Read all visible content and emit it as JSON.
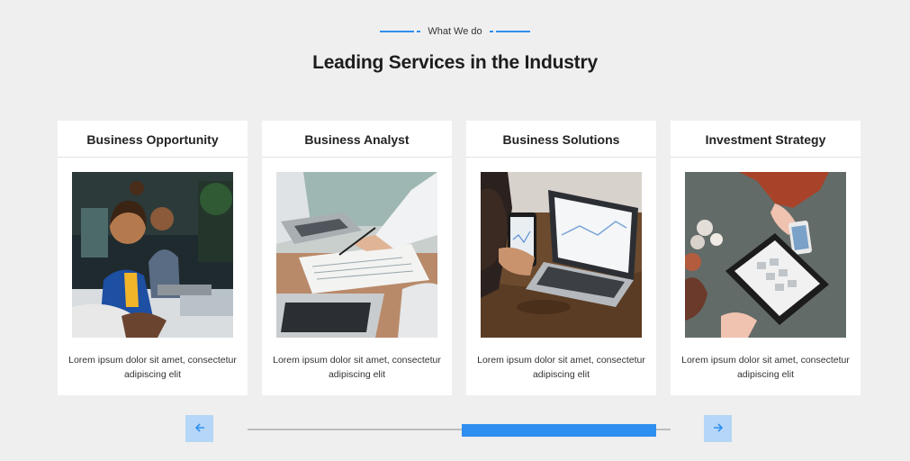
{
  "header": {
    "eyebrow": "What We do",
    "title": "Leading Services in the Industry"
  },
  "cards": [
    {
      "title": "Business Opportunity",
      "text": "Lorem ipsum dolor sit amet, consectetur adipiscing elit"
    },
    {
      "title": "Business Analyst",
      "text": "Lorem ipsum dolor sit amet, consectetur adipiscing elit"
    },
    {
      "title": "Business Solutions",
      "text": "Lorem ipsum dolor sit amet, consectetur adipiscing elit"
    },
    {
      "title": "Investment Strategy",
      "text": "Lorem ipsum dolor sit amet, consectetur adipiscing elit"
    }
  ],
  "slider": {
    "prev_icon": "arrow-left-icon",
    "next_icon": "arrow-right-icon"
  },
  "colors": {
    "accent": "#2f8ff0",
    "button_bg": "#b5d6f7",
    "page_bg": "#efefef"
  }
}
